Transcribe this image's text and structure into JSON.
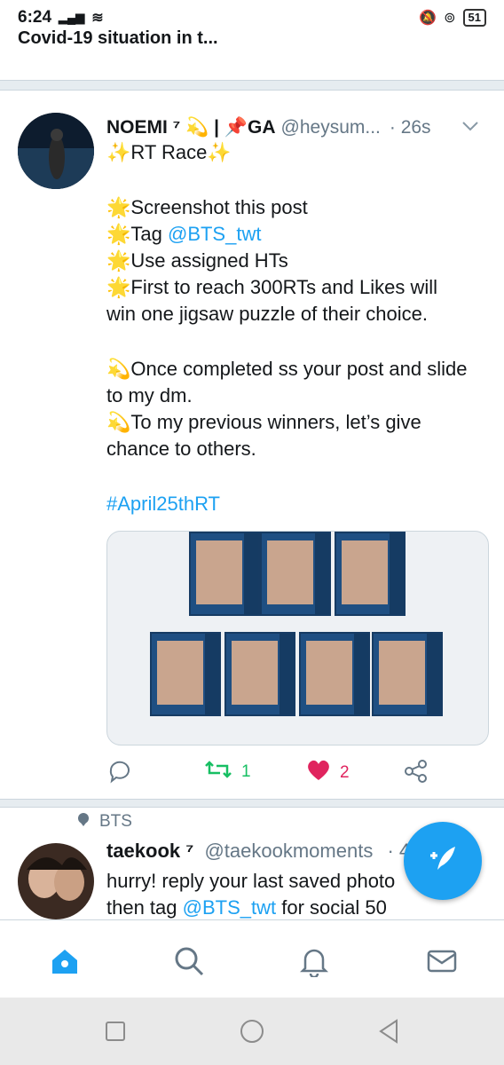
{
  "status_bar": {
    "time": "6:24",
    "battery": "51"
  },
  "previous_tweet": {
    "text": "Covid-19 situation in t..."
  },
  "tweet": {
    "name": "NOEMI ⁷ 💫 | 📌GA",
    "handle": "@heysum...",
    "time": "· 26s",
    "lines": [
      "✨RT Race✨",
      "",
      "🌟Screenshot this post",
      "🌟Tag ",
      "🌟Use assigned HTs",
      "🌟First to reach 300RTs and Likes will win one jigsaw puzzle of their choice.",
      "",
      "💫Once completed ss your post and slide to my dm.",
      "💫To my previous winners, let’s give chance to others.",
      "",
      "#April25thRT"
    ],
    "tag_mention": "@BTS_twt",
    "retweet_count": "1",
    "like_count": "2"
  },
  "next_tweet": {
    "context": "BTS",
    "name": "taekook ⁷",
    "handle": "@taekookmoments",
    "time": "· 4",
    "text_line1": "hurry! reply your last saved photo",
    "text_line2_prefix": "then tag ",
    "mention": "@BTS_twt",
    "text_line2_suffix": " for social 50"
  },
  "colors": {
    "accent": "#1da1f2",
    "retweet": "#17bf63",
    "like": "#e0245e"
  }
}
